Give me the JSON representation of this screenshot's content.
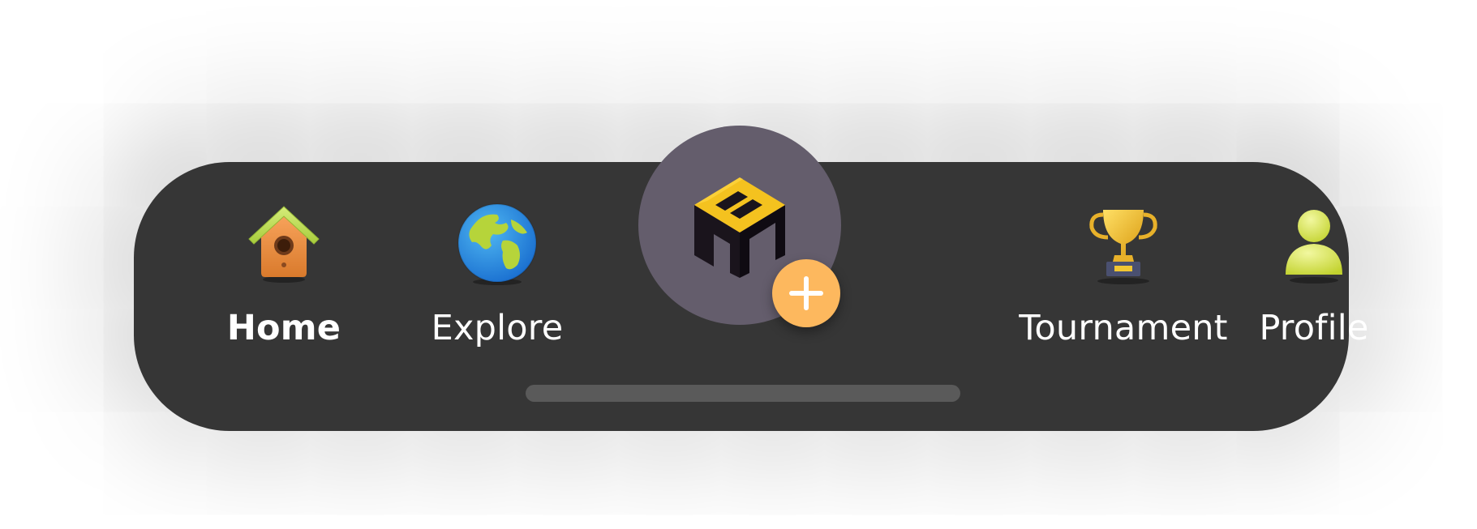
{
  "nav": {
    "items": [
      {
        "label": "Home",
        "icon": "birdhouse-icon",
        "active": true
      },
      {
        "label": "Explore",
        "icon": "globe-icon",
        "active": false
      },
      {
        "label": "Tournament",
        "icon": "trophy-icon",
        "active": false
      },
      {
        "label": "Profile",
        "icon": "person-icon",
        "active": false
      }
    ],
    "center": {
      "icon": "m-logo-icon",
      "badge_icon": "plus-icon"
    }
  },
  "colors": {
    "navbar_bg": "#363636",
    "center_circle": "#645d6c",
    "plus_badge": "#fdb85e",
    "label": "#ffffff",
    "home_indicator": "#5a5a5a"
  }
}
